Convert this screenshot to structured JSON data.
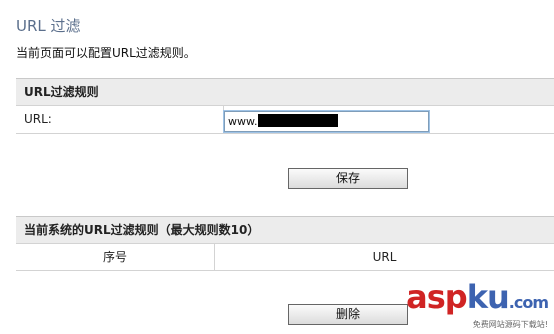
{
  "page": {
    "title": "URL 过滤",
    "description": "当前页面可以配置URL过滤规则。"
  },
  "rule_section": {
    "heading": "URL过滤规则",
    "url_label": "URL:",
    "url_value": "www."
  },
  "save_button": "保存",
  "list_section": {
    "heading": "当前系统的URL过滤规则（最大规则数10）",
    "columns": [
      "序号",
      "URL"
    ]
  },
  "delete_button": "删除",
  "watermark": {
    "asp": "asp",
    "ku": "ku",
    "com": ".com",
    "subtitle": "免费网站源码下载站!"
  }
}
